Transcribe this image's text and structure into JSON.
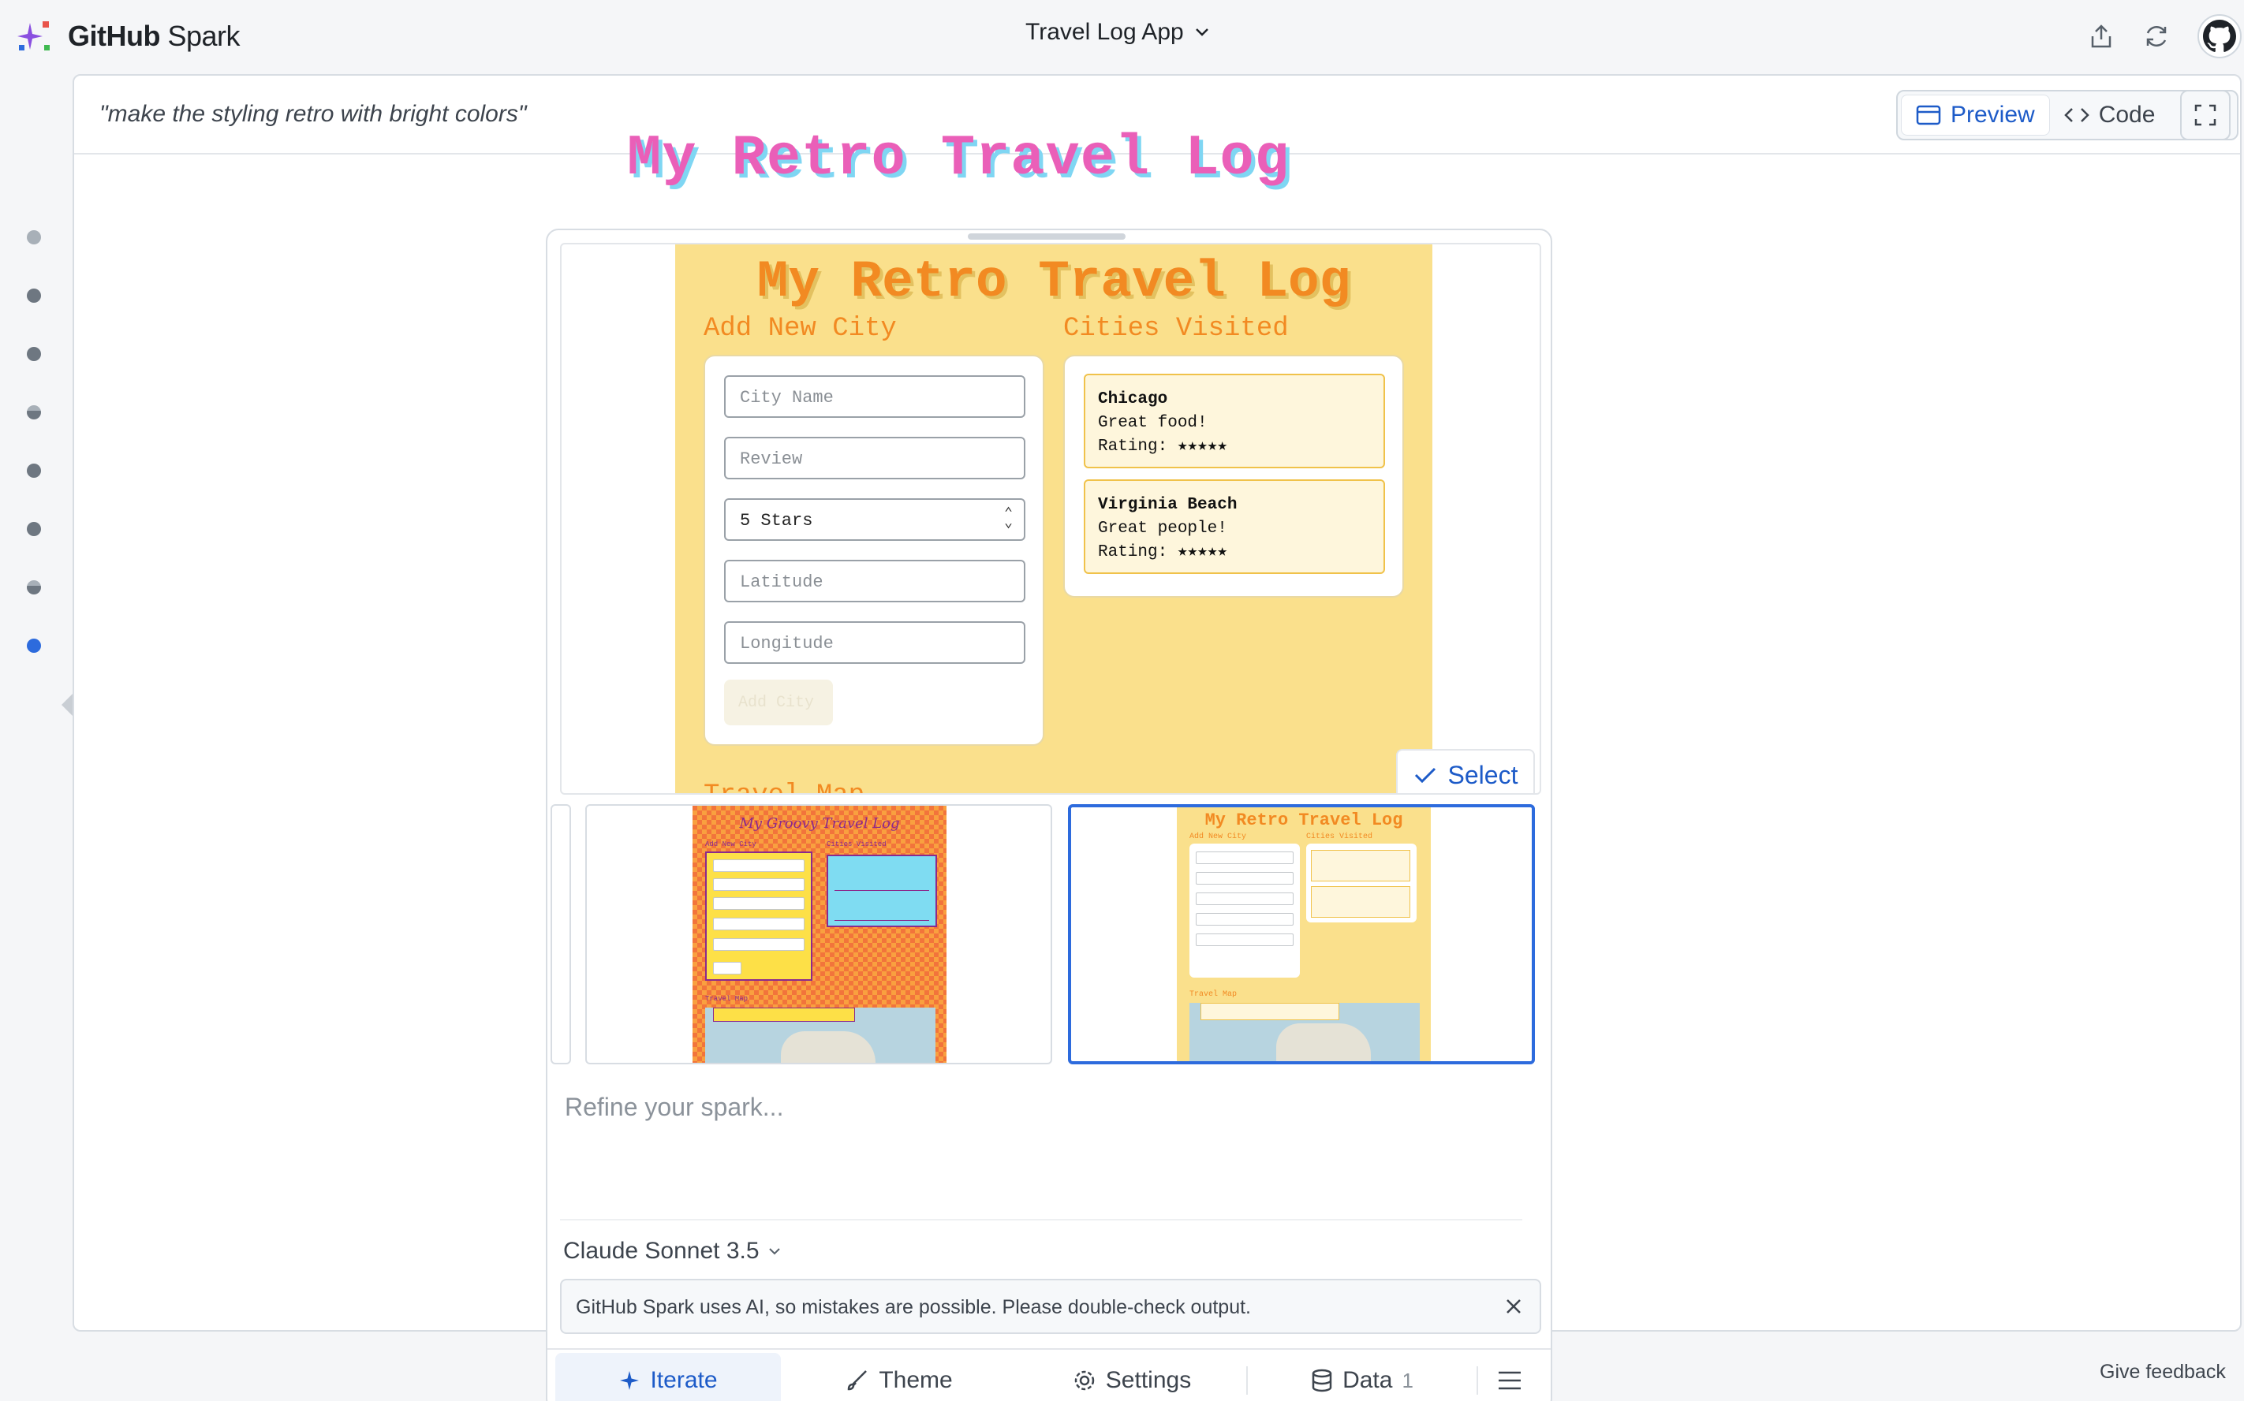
{
  "brand": {
    "bold": "GitHub",
    "light": "Spark"
  },
  "app_title": "Travel Log App",
  "prompt": "\"make the styling retro with bright colors\"",
  "view_toggle": {
    "preview": "Preview",
    "code": "Code"
  },
  "big_title": "My Retro Travel Log",
  "retro_app": {
    "title": "My Retro Travel Log",
    "add_heading": "Add New City",
    "cities_heading": "Cities Visited",
    "fields": {
      "city": "City Name",
      "review": "Review",
      "stars": "5 Stars",
      "latitude": "Latitude",
      "longitude": "Longitude"
    },
    "add_button": "Add City",
    "cities": [
      {
        "name": "Chicago",
        "review": "Great food!",
        "rating": "Rating: ★★★★★"
      },
      {
        "name": "Virginia Beach",
        "review": "Great people!",
        "rating": "Rating: ★★★★★"
      }
    ],
    "bottom_heading": "Travel Map"
  },
  "select_button": "Select",
  "thumb_groovy": {
    "title": "My Groovy Travel Log",
    "add_heading": "Add New City",
    "cities_heading": "Cities Visited",
    "map_heading": "Travel Map"
  },
  "thumb_retro": {
    "title": "My Retro Travel Log",
    "add_heading": "Add New City",
    "cities_heading": "Cities Visited",
    "map_heading": "Travel Map"
  },
  "refine_placeholder": "Refine your spark...",
  "model": "Claude Sonnet 3.5",
  "notice": "GitHub Spark uses AI, so mistakes are possible. Please double-check output.",
  "tabs": {
    "iterate": "Iterate",
    "theme": "Theme",
    "settings": "Settings",
    "data": "Data",
    "data_count": "1"
  },
  "feedback": "Give feedback",
  "colors": {
    "accent": "#2d6bdd",
    "retro_bg": "#fae08c",
    "retro_orange": "#f28a22",
    "title_pink": "#ea5fb8",
    "title_shadow": "#7fd6f3"
  }
}
